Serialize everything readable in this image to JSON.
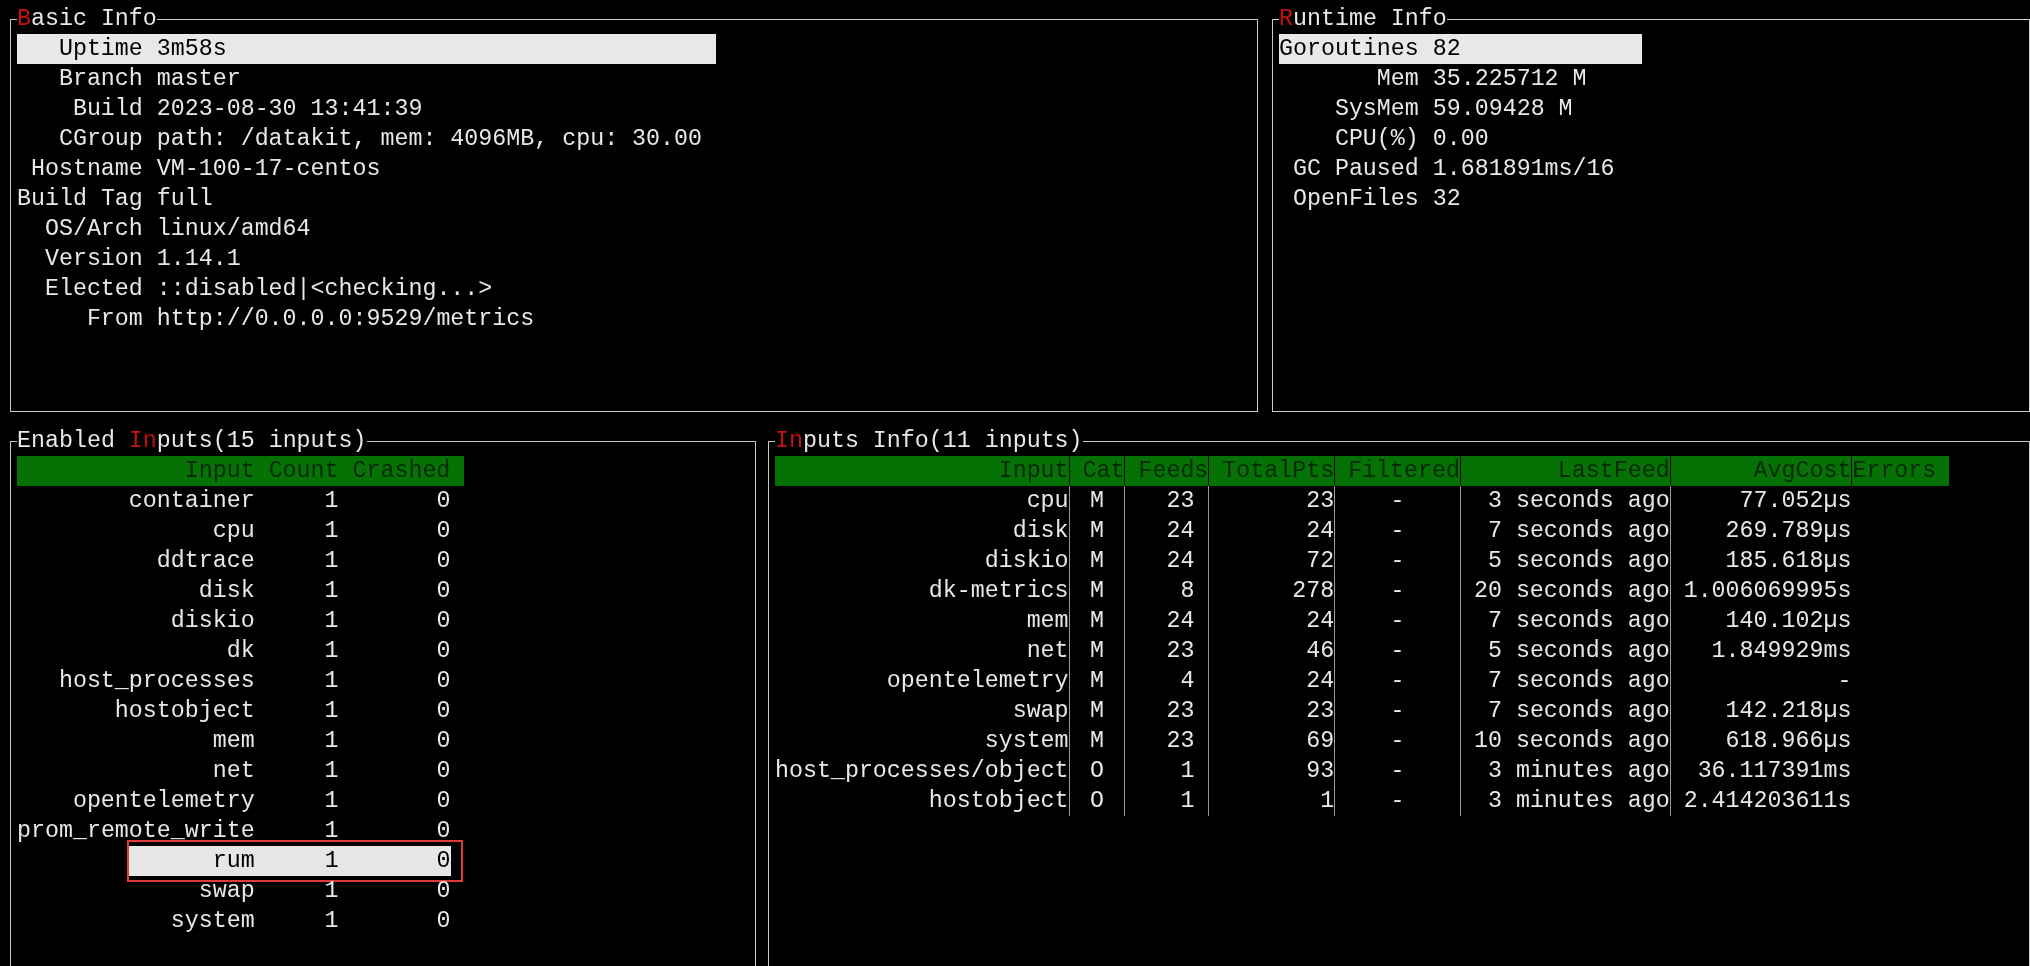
{
  "basic_info": {
    "title_parts": [
      {
        "kind": "hotkey",
        "text": "B"
      },
      {
        "kind": "plain",
        "text": "asic Info"
      }
    ],
    "rows": [
      {
        "label": "Uptime",
        "value": "3m58s",
        "selected": true
      },
      {
        "label": "Branch",
        "value": "master",
        "selected": false
      },
      {
        "label": "Build",
        "value": "2023-08-30 13:41:39",
        "selected": false
      },
      {
        "label": "CGroup",
        "value": "path: /datakit, mem: 4096MB, cpu: 30.00",
        "selected": false
      },
      {
        "label": "Hostname",
        "value": "VM-100-17-centos",
        "selected": false
      },
      {
        "label": "Build Tag",
        "value": "full",
        "selected": false
      },
      {
        "label": "OS/Arch",
        "value": "linux/amd64",
        "selected": false
      },
      {
        "label": "Version",
        "value": "1.14.1",
        "selected": false
      },
      {
        "label": "Elected",
        "value": "::disabled|<checking...>",
        "selected": false
      },
      {
        "label": "From",
        "value": "http://0.0.0.0:9529/metrics",
        "selected": false
      }
    ]
  },
  "runtime_info": {
    "title_parts": [
      {
        "kind": "hotkey",
        "text": "R"
      },
      {
        "kind": "plain",
        "text": "untime Info"
      }
    ],
    "rows": [
      {
        "label": "Goroutines",
        "value": "82",
        "selected": true
      },
      {
        "label": "Mem",
        "value": "35.225712 M",
        "selected": false
      },
      {
        "label": "SysMem",
        "value": "59.09428 M",
        "selected": false
      },
      {
        "label": "CPU(%)",
        "value": "0.00",
        "selected": false
      },
      {
        "label": "GC Paused",
        "value": "1.681891ms/16",
        "selected": false
      },
      {
        "label": "OpenFiles",
        "value": "32",
        "selected": false
      }
    ]
  },
  "enabled_inputs": {
    "title_parts": [
      {
        "kind": "plain",
        "text": "Enabled "
      },
      {
        "kind": "hotkey",
        "text": "In"
      },
      {
        "kind": "plain",
        "text": "puts(15 inputs)"
      }
    ],
    "columns": [
      "Input",
      "Count",
      "Crashed"
    ],
    "rows": [
      {
        "cells": [
          "container",
          "1",
          "0"
        ],
        "selected": false
      },
      {
        "cells": [
          "cpu",
          "1",
          "0"
        ],
        "selected": false
      },
      {
        "cells": [
          "ddtrace",
          "1",
          "0"
        ],
        "selected": false
      },
      {
        "cells": [
          "disk",
          "1",
          "0"
        ],
        "selected": false
      },
      {
        "cells": [
          "diskio",
          "1",
          "0"
        ],
        "selected": false
      },
      {
        "cells": [
          "dk",
          "1",
          "0"
        ],
        "selected": false
      },
      {
        "cells": [
          "host_processes",
          "1",
          "0"
        ],
        "selected": false
      },
      {
        "cells": [
          "hostobject",
          "1",
          "0"
        ],
        "selected": false
      },
      {
        "cells": [
          "mem",
          "1",
          "0"
        ],
        "selected": false
      },
      {
        "cells": [
          "net",
          "1",
          "0"
        ],
        "selected": false
      },
      {
        "cells": [
          "opentelemetry",
          "1",
          "0"
        ],
        "selected": false
      },
      {
        "cells": [
          "prom_remote_write",
          "1",
          "0"
        ],
        "selected": false
      },
      {
        "cells": [
          "rum",
          "1",
          "0"
        ],
        "selected": true
      },
      {
        "cells": [
          "swap",
          "1",
          "0"
        ],
        "selected": false
      },
      {
        "cells": [
          "system",
          "1",
          "0"
        ],
        "selected": false
      }
    ]
  },
  "inputs_info": {
    "title_parts": [
      {
        "kind": "hotkey",
        "text": "In"
      },
      {
        "kind": "plain",
        "text": "puts Info(11 inputs)"
      }
    ],
    "columns": [
      "Input",
      "Cat",
      "Feeds",
      "TotalPts",
      "Filtered",
      "LastFeed",
      "AvgCost",
      "Errors"
    ],
    "rows": [
      [
        "cpu",
        "M",
        "23",
        "23",
        "-",
        "3 seconds ago",
        "77.052µs"
      ],
      [
        "disk",
        "M",
        "24",
        "24",
        "-",
        "7 seconds ago",
        "269.789µs"
      ],
      [
        "diskio",
        "M",
        "24",
        "72",
        "-",
        "5 seconds ago",
        "185.618µs"
      ],
      [
        "dk-metrics",
        "M",
        "8",
        "278",
        "-",
        "20 seconds ago",
        "1.006069995s"
      ],
      [
        "mem",
        "M",
        "24",
        "24",
        "-",
        "7 seconds ago",
        "140.102µs"
      ],
      [
        "net",
        "M",
        "23",
        "46",
        "-",
        "5 seconds ago",
        "1.849929ms"
      ],
      [
        "opentelemetry",
        "M",
        "4",
        "24",
        "-",
        "7 seconds ago",
        "-"
      ],
      [
        "swap",
        "M",
        "23",
        "23",
        "-",
        "7 seconds ago",
        "142.218µs"
      ],
      [
        "system",
        "M",
        "23",
        "69",
        "-",
        "10 seconds ago",
        "618.966µs"
      ],
      [
        "host_processes/object",
        "O",
        "1",
        "93",
        "-",
        "3 minutes ago",
        "36.117391ms"
      ],
      [
        "hostobject",
        "O",
        "1",
        "1",
        "-",
        "3 minutes ago",
        "2.414203611s"
      ]
    ]
  }
}
